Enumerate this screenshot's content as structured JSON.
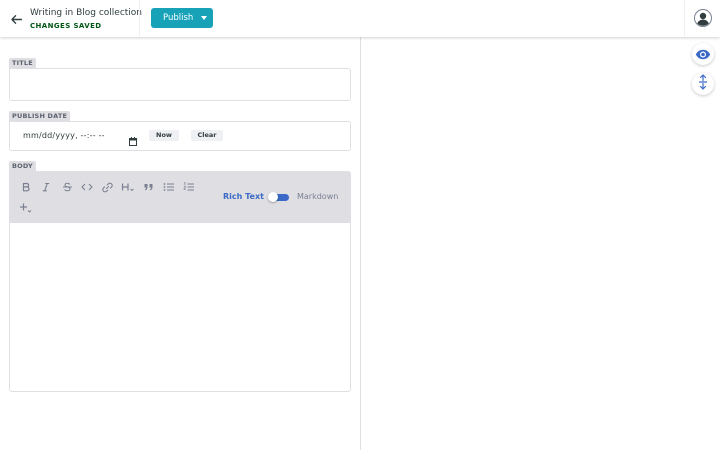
{
  "header": {
    "collection_title": "Writing in Blog collection",
    "save_status": "CHANGES SAVED",
    "publish_label": "Publish",
    "icons": {
      "back": "arrow-left-icon",
      "publish_dropdown": "caret-down-icon",
      "avatar": "user-avatar-icon"
    }
  },
  "fields": {
    "title": {
      "label": "TITLE",
      "value": ""
    },
    "publish_date": {
      "label": "PUBLISH DATE",
      "value": "mm/dd/yyyy, --:-- --",
      "now_label": "Now",
      "clear_label": "Clear"
    },
    "body": {
      "label": "BODY",
      "value": "",
      "toolbar": [
        "bold-icon",
        "italic-icon",
        "strikethrough-icon",
        "code-icon",
        "link-icon",
        "heading-icon",
        "quote-icon",
        "bulleted-list-icon",
        "numbered-list-icon",
        "add-component-icon"
      ],
      "rich_text_label": "Rich Text",
      "markdown_label": "Markdown",
      "mode": "Rich Text"
    }
  },
  "side_buttons": [
    "eye-icon",
    "sync-scroll-icon"
  ],
  "colors": {
    "accent": "#17a2b8",
    "saved_status": "#005614",
    "rich_text_active": "#3a69c7",
    "label_background": "#dfdfe3"
  }
}
